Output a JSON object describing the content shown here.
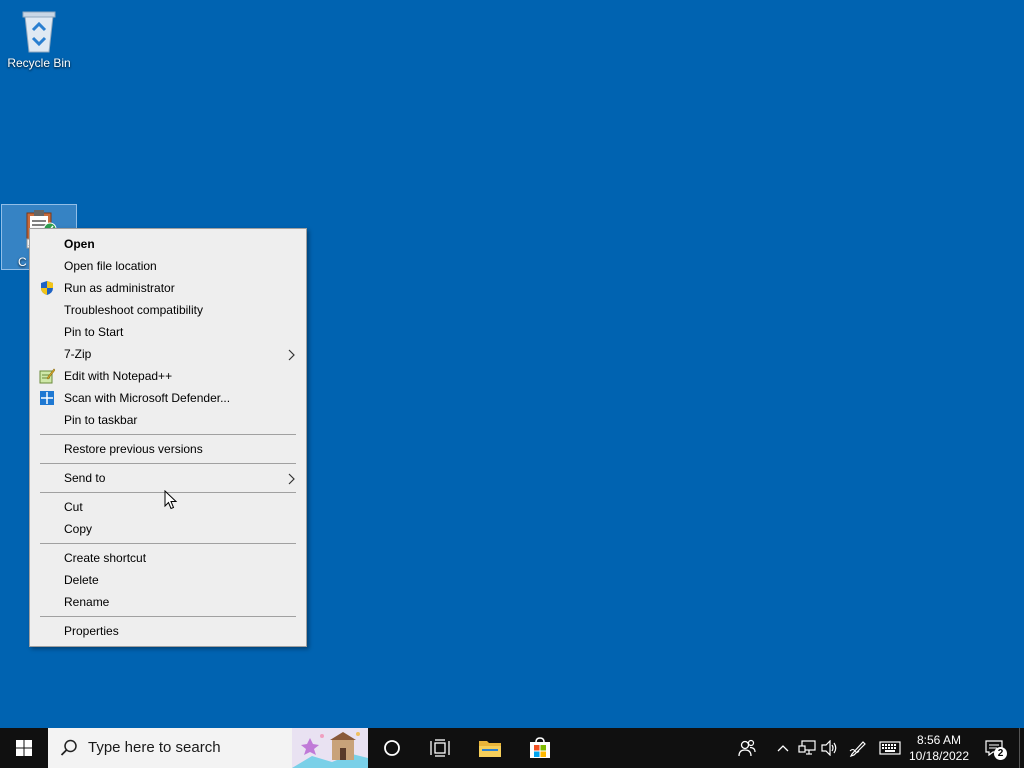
{
  "desktop": {
    "icons": [
      {
        "label": "Recycle Bin"
      },
      {
        "label": "C"
      }
    ]
  },
  "context_menu": {
    "groups": [
      [
        {
          "label": "Open",
          "bold": true,
          "icon": null,
          "submenu": false
        },
        {
          "label": "Open file location",
          "icon": null,
          "submenu": false
        },
        {
          "label": "Run as administrator",
          "icon": "uac-shield-icon",
          "submenu": false
        },
        {
          "label": "Troubleshoot compatibility",
          "icon": null,
          "submenu": false
        },
        {
          "label": "Pin to Start",
          "icon": null,
          "submenu": false
        },
        {
          "label": "7-Zip",
          "icon": null,
          "submenu": true
        },
        {
          "label": "Edit with Notepad++",
          "icon": "notepad-plus-plus-icon",
          "submenu": false
        },
        {
          "label": "Scan with Microsoft Defender...",
          "icon": "defender-icon",
          "submenu": false
        },
        {
          "label": "Pin to taskbar",
          "icon": null,
          "submenu": false
        }
      ],
      [
        {
          "label": "Restore previous versions",
          "icon": null,
          "submenu": false
        }
      ],
      [
        {
          "label": "Send to",
          "icon": null,
          "submenu": true
        }
      ],
      [
        {
          "label": "Cut",
          "icon": null,
          "submenu": false
        },
        {
          "label": "Copy",
          "icon": null,
          "submenu": false
        }
      ],
      [
        {
          "label": "Create shortcut",
          "icon": null,
          "submenu": false
        },
        {
          "label": "Delete",
          "icon": null,
          "submenu": false
        },
        {
          "label": "Rename",
          "icon": null,
          "submenu": false
        }
      ],
      [
        {
          "label": "Properties",
          "icon": null,
          "submenu": false
        }
      ]
    ]
  },
  "taskbar": {
    "search_placeholder": "Type here to search",
    "clock_time": "8:56 AM",
    "clock_date": "10/18/2022",
    "notification_count": "2",
    "pinned": [
      "cortana-icon",
      "task-view-icon",
      "file-explorer-icon",
      "microsoft-store-icon"
    ],
    "tray": [
      "people-icon",
      "chevron-up-icon",
      "network-icon",
      "volume-icon",
      "pen-icon",
      "touch-keyboard-icon"
    ]
  },
  "colors": {
    "desktop_bg": "#0063b1",
    "taskbar_bg": "#101010",
    "menu_bg": "#eeeeee",
    "accent": "#0078d7"
  }
}
